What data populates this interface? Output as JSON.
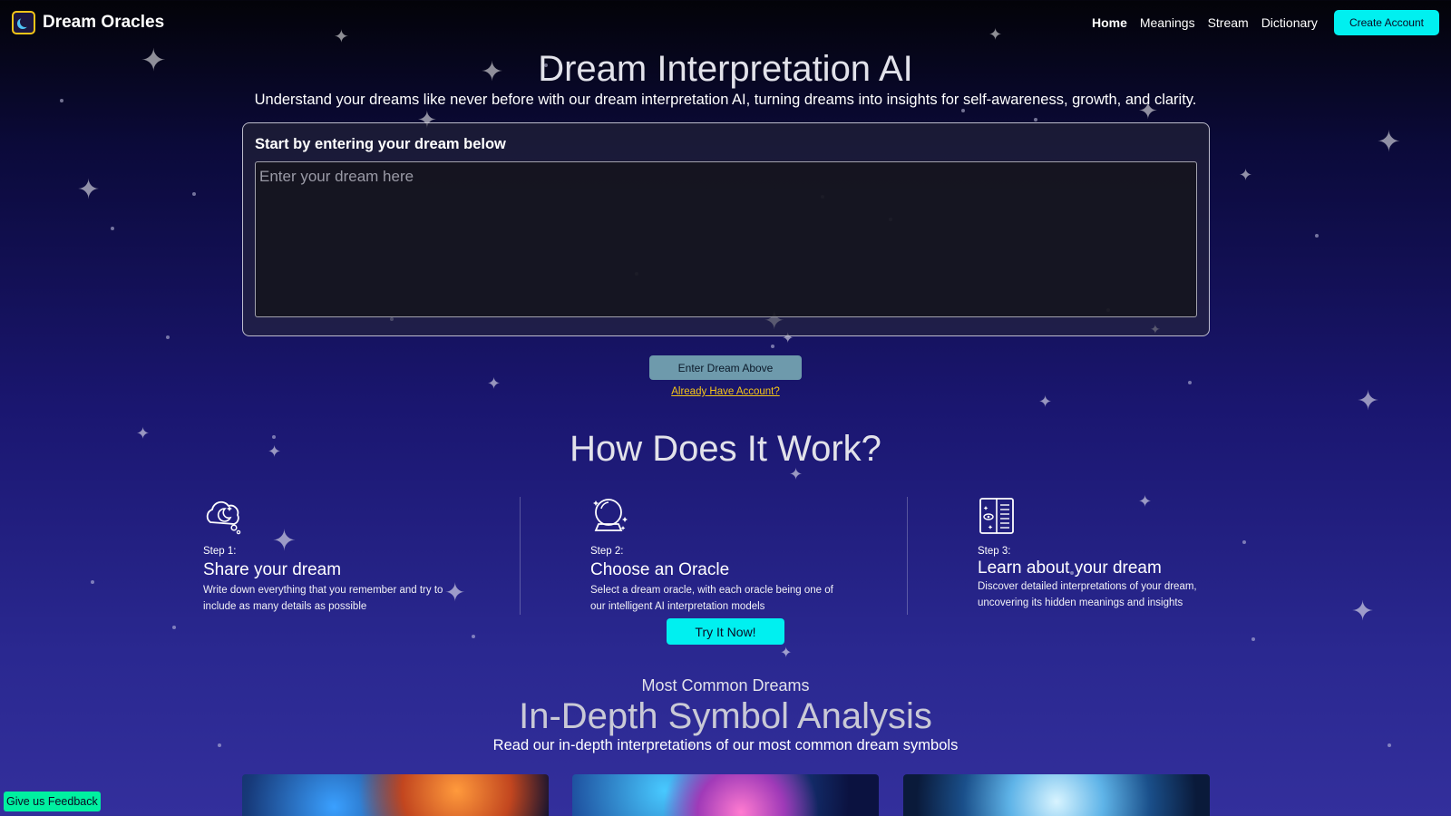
{
  "nav": {
    "brand": "Dream Oracles",
    "links": [
      "Home",
      "Meanings",
      "Stream",
      "Dictionary"
    ],
    "cta": "Create Account"
  },
  "hero": {
    "title": "Dream Interpretation AI",
    "subtitle": "Understand your dreams like never before with our dream interpretation AI, turning dreams into insights for self-awareness, growth, and clarity."
  },
  "dream_form": {
    "label": "Start by entering your dream below",
    "placeholder": "Enter your dream here",
    "value": "",
    "submit_label": "Enter Dream Above",
    "account_link": "Already Have Account?"
  },
  "how": {
    "title": "How Does It Work?",
    "steps": [
      {
        "number": "Step 1:",
        "title": "Share your dream",
        "description": "Write down everything that you remember and try to include as many details as possible",
        "icon": "moon-cloud-icon"
      },
      {
        "number": "Step 2:",
        "title": "Choose an Oracle",
        "description": "Select a dream oracle, with each oracle being one of our intelligent AI interpretation models",
        "icon": "crystal-ball-icon"
      },
      {
        "number": "Step 3:",
        "title": "Learn about your dream",
        "description": "Discover detailed interpretations of your dream, uncovering its hidden meanings and insights",
        "icon": "open-book-icon"
      }
    ],
    "cta": "Try It Now!"
  },
  "symbols": {
    "eyebrow": "Most Common Dreams",
    "title": "In-Depth Symbol Analysis",
    "subtitle": "Read our in-depth interpretations of our most common dream symbols"
  },
  "feedback_label": "Give us Feedback",
  "colors": {
    "accent": "#00f0f0",
    "link": "#f5c518",
    "feedback": "#00f0a0",
    "submit_disabled": "#6e9aac"
  }
}
